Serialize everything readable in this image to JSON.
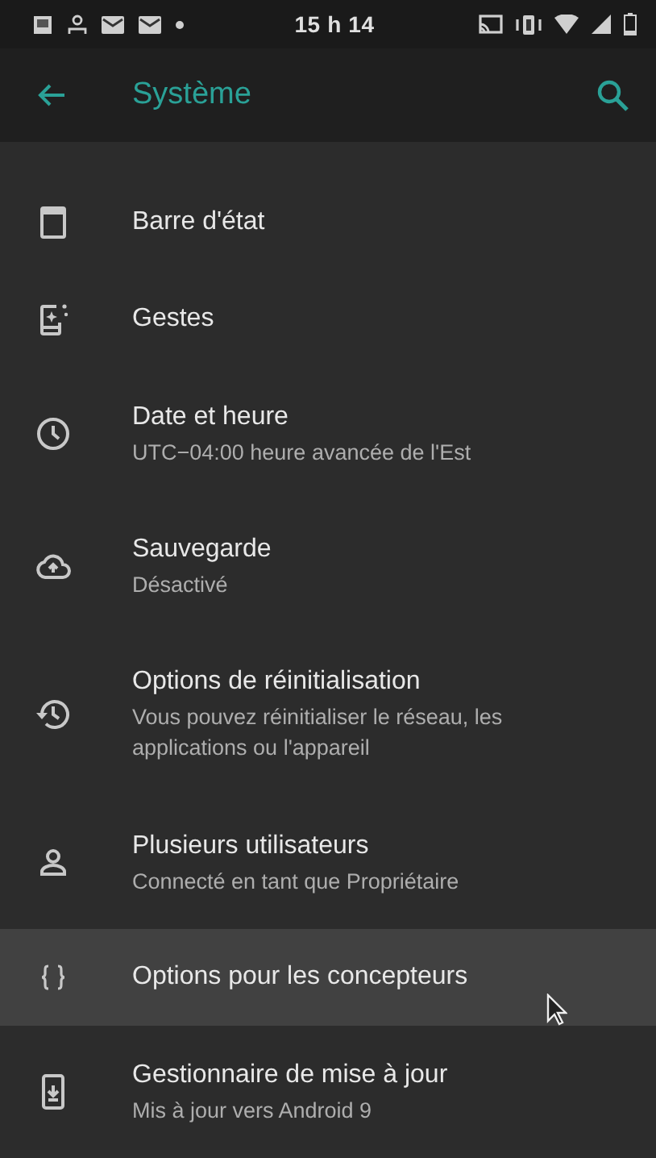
{
  "status_bar": {
    "time": "15 h 14"
  },
  "toolbar": {
    "title": "Système"
  },
  "items": [
    {
      "title": "Barre d'état",
      "highlighted": false
    },
    {
      "title": "Gestes",
      "highlighted": false
    },
    {
      "title": "Date et heure",
      "summary": "UTC−04:00 heure avancée de l'Est",
      "highlighted": false
    },
    {
      "title": "Sauvegarde",
      "summary": "Désactivé",
      "highlighted": false
    },
    {
      "title": "Options de réinitialisation",
      "summary": "Vous pouvez réinitialiser le réseau, les applications ou l'appareil",
      "highlighted": false
    },
    {
      "title": "Plusieurs utilisateurs",
      "summary": "Connecté en tant que Propriétaire",
      "highlighted": false
    },
    {
      "title": "Options pour les concepteurs",
      "highlighted": true
    },
    {
      "title": "Gestionnaire de mise à jour",
      "summary": "Mis à jour vers Android 9",
      "highlighted": false
    }
  ]
}
